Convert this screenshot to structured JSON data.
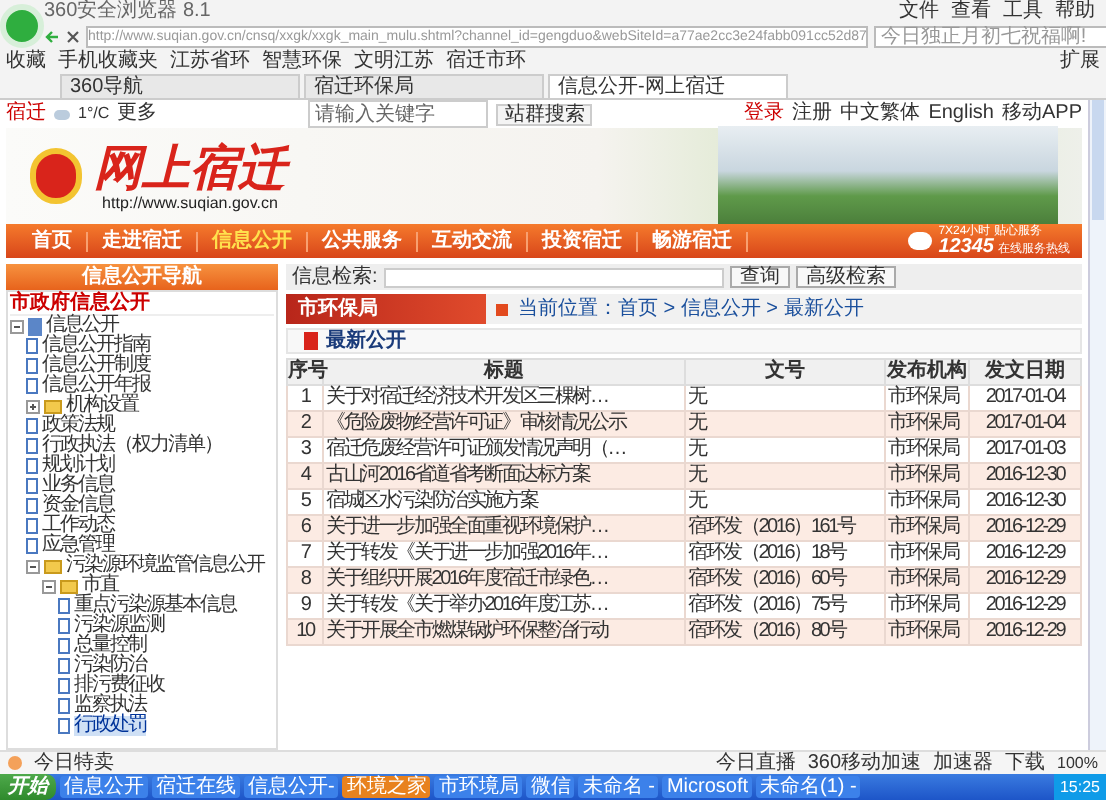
{
  "browser": {
    "title": "360安全浏览器 8.1",
    "menu": [
      "文件",
      "查看",
      "工具",
      "帮助"
    ],
    "url": "http://www.suqian.gov.cn/cnsq/xxgk/xxgk_main_mulu.shtml?channel_id=gengduo&webSiteId=a77ae2cc3e24fabb091cc52d87",
    "search_placeholder": "今日独正月初七祝福啊!",
    "bookmarks": [
      "收藏",
      "手机收藏夹",
      "江苏省环",
      "智慧环保",
      "文明江苏",
      "宿迁市环"
    ],
    "extensions": "扩展",
    "tabs": [
      {
        "label": "360导航",
        "selected": false
      },
      {
        "label": "宿迁环保局",
        "selected": false
      },
      {
        "label": "信息公开-网上宿迁",
        "selected": true
      }
    ]
  },
  "site": {
    "topbar": {
      "city": "宿迁",
      "weather": "1°/C",
      "more": "更多",
      "search_placeholder": "请输入关键字",
      "search_button": "站群搜索",
      "links": [
        "登录",
        "注册",
        "中文繁体",
        "English",
        "移动APP"
      ]
    },
    "logo_title": "网上宿迁",
    "logo_url": "http://www.suqian.gov.cn",
    "nav": [
      {
        "label": "首页",
        "selected": false
      },
      {
        "label": "走进宿迁",
        "selected": false
      },
      {
        "label": "信息公开",
        "selected": true
      },
      {
        "label": "公共服务",
        "selected": false
      },
      {
        "label": "互动交流",
        "selected": false
      },
      {
        "label": "投资宿迁",
        "selected": false
      },
      {
        "label": "畅游宿迁",
        "selected": false
      }
    ],
    "hotline": {
      "caption": "7X24小时 贴心服务",
      "number": "12345",
      "subtitle": "在线服务热线"
    }
  },
  "sidebar": {
    "title": "信息公开导航",
    "section": "市政府信息公开",
    "tree": [
      {
        "label": "信息公开",
        "kind": "root",
        "expanded": true,
        "selected": false,
        "children": [
          {
            "label": "信息公开指南",
            "kind": "page",
            "selected": false
          },
          {
            "label": "信息公开制度",
            "kind": "page",
            "selected": false
          },
          {
            "label": "信息公开年报",
            "kind": "page",
            "selected": false
          },
          {
            "label": "机构设置",
            "kind": "folder",
            "expanded": false,
            "selected": false
          },
          {
            "label": "政策法规",
            "kind": "page",
            "selected": false
          },
          {
            "label": "行政执法（权力清单）",
            "kind": "page",
            "selected": false
          },
          {
            "label": "规划计划",
            "kind": "page",
            "selected": false
          },
          {
            "label": "业务信息",
            "kind": "page",
            "selected": false
          },
          {
            "label": "资金信息",
            "kind": "page",
            "selected": false
          },
          {
            "label": "工作动态",
            "kind": "page",
            "selected": false
          },
          {
            "label": "应急管理",
            "kind": "page",
            "selected": false
          },
          {
            "label": "污染源环境监管信息公开",
            "kind": "folder",
            "expanded": true,
            "selected": false,
            "children": [
              {
                "label": "市直",
                "kind": "folder",
                "expanded": true,
                "selected": false,
                "children": [
                  {
                    "label": "重点污染源基本信息",
                    "kind": "page",
                    "selected": false
                  },
                  {
                    "label": "污染源监测",
                    "kind": "page",
                    "selected": false
                  },
                  {
                    "label": "总量控制",
                    "kind": "page",
                    "selected": false
                  },
                  {
                    "label": "污染防治",
                    "kind": "page",
                    "selected": false
                  },
                  {
                    "label": "排污费征收",
                    "kind": "page",
                    "selected": false
                  },
                  {
                    "label": "监察执法",
                    "kind": "page",
                    "selected": false
                  },
                  {
                    "label": "行政处罚",
                    "kind": "page",
                    "selected": true
                  }
                ]
              }
            ]
          }
        ]
      }
    ]
  },
  "main": {
    "search_label": "信息检索:",
    "buttons": [
      "查询",
      "高级检索"
    ],
    "department": "市环保局",
    "breadcrumb": "当前位置：首页 > 信息公开 > 最新公开",
    "section": "最新公开",
    "columns": [
      "序号",
      "标题",
      "文号",
      "发布机构",
      "发文日期"
    ],
    "rows": [
      [
        "1",
        "关于对宿迁经济技术开发区三棵树…",
        "无",
        "市环保局",
        "2017-01-04"
      ],
      [
        "2",
        "《危险废物经营许可证》审核情况公示",
        "无",
        "市环保局",
        "2017-01-04"
      ],
      [
        "3",
        "宿迁危废经营许可证颁发情况声明（…",
        "无",
        "市环保局",
        "2017-01-03"
      ],
      [
        "4",
        "古山河2016省道省考断面达标方案",
        "无",
        "市环保局",
        "2016-12-30"
      ],
      [
        "5",
        "宿城区水污染防治实施方案",
        "无",
        "市环保局",
        "2016-12-30"
      ],
      [
        "6",
        "关于进一步加强全面重视环境保护…",
        "宿环发（2016）161号",
        "市环保局",
        "2016-12-29"
      ],
      [
        "7",
        "关于转发《关于进一步加强2016年…",
        "宿环发（2016）18号",
        "市环保局",
        "2016-12-29"
      ],
      [
        "8",
        "关于组织开展2016年度宿迁市绿色…",
        "宿环发（2016）60号",
        "市环保局",
        "2016-12-29"
      ],
      [
        "9",
        "关于转发《关于举办2016年度江苏…",
        "宿环发（2016）75号",
        "市环保局",
        "2016-12-29"
      ],
      [
        "10",
        "关于开展全市燃煤锅炉环保整治行动",
        "宿环发（2016）80号",
        "市环保局",
        "2016-12-29"
      ]
    ]
  },
  "status_bar": {
    "left": "今日特卖",
    "items": [
      "今日直播",
      "360移动加速",
      "加速器",
      "下载"
    ],
    "zoom": "100%"
  },
  "taskbar": {
    "start": "开始",
    "items": [
      {
        "label": "信息公开",
        "selected": false
      },
      {
        "label": "宿迁在线",
        "selected": false
      },
      {
        "label": "信息公开-",
        "selected": false
      },
      {
        "label": "环境之家",
        "selected": true
      },
      {
        "label": "市环境局",
        "selected": false
      },
      {
        "label": "微信",
        "selected": false
      },
      {
        "label": "未命名 -",
        "selected": false
      },
      {
        "label": "Microsoft",
        "selected": false
      },
      {
        "label": "未命名(1) -",
        "selected": false
      }
    ],
    "clock": "15:25"
  }
}
